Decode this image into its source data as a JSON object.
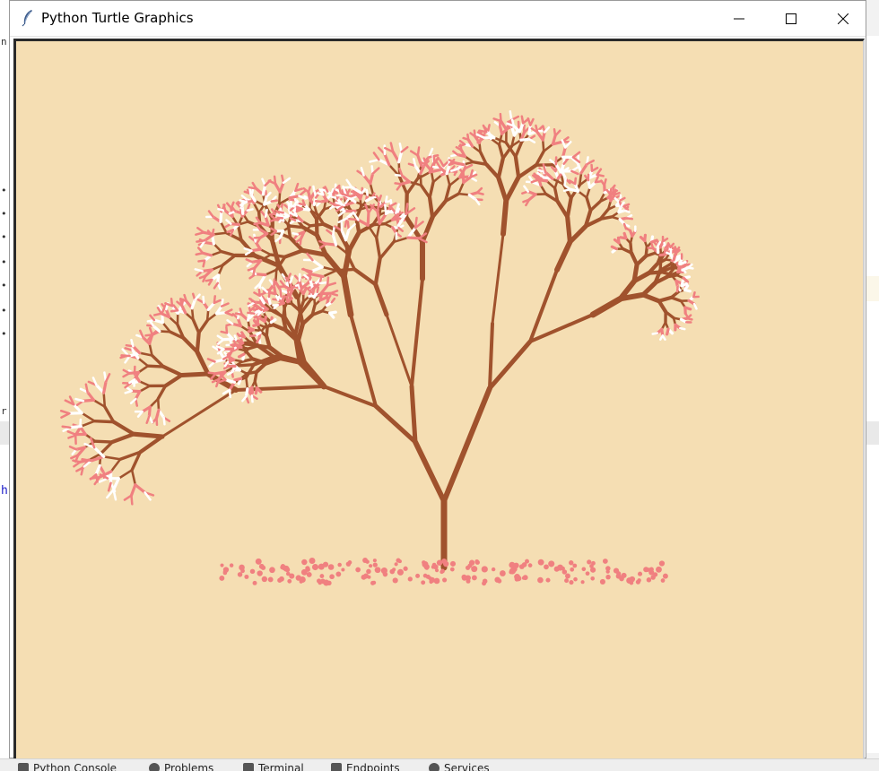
{
  "window": {
    "title": "Python Turtle Graphics",
    "controls": [
      "minimize",
      "maximize",
      "close"
    ]
  },
  "canvas": {
    "background_color": "#f5deb3",
    "trunk_color": "#a0522d",
    "blossom_color": "#f08080",
    "highlight_color": "#ffffff",
    "drawing": "fractal cherry blossom tree with fallen petals"
  },
  "ide": {
    "left_marks": [
      "n",
      "•",
      "•",
      "•",
      "•",
      "•",
      "•",
      "•",
      "•",
      "r"
    ],
    "left_link_char": "h",
    "bottom_tools": [
      {
        "label": "Python Console",
        "icon": "python-icon"
      },
      {
        "label": "Problems",
        "icon": "problems-icon"
      },
      {
        "label": "Terminal",
        "icon": "terminal-icon"
      },
      {
        "label": "Endpoints",
        "icon": "endpoints-icon"
      },
      {
        "label": "Services",
        "icon": "services-icon"
      }
    ]
  }
}
